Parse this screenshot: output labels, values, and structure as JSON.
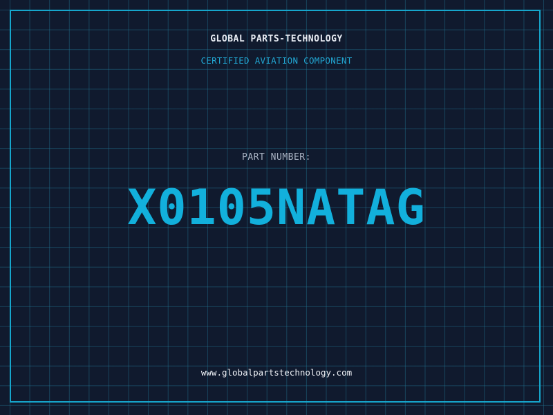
{
  "header": {
    "company": "GLOBAL PARTS-TECHNOLOGY",
    "tagline": "CERTIFIED AVIATION COMPONENT"
  },
  "part": {
    "label": "PART NUMBER:",
    "number": "X0105NATAG"
  },
  "footer": {
    "website": "www.globalpartstechnology.com"
  },
  "colors": {
    "background": "#101a2e",
    "grid": "#22788f",
    "accent": "#12b0dc",
    "text": "#e8ecf3"
  }
}
